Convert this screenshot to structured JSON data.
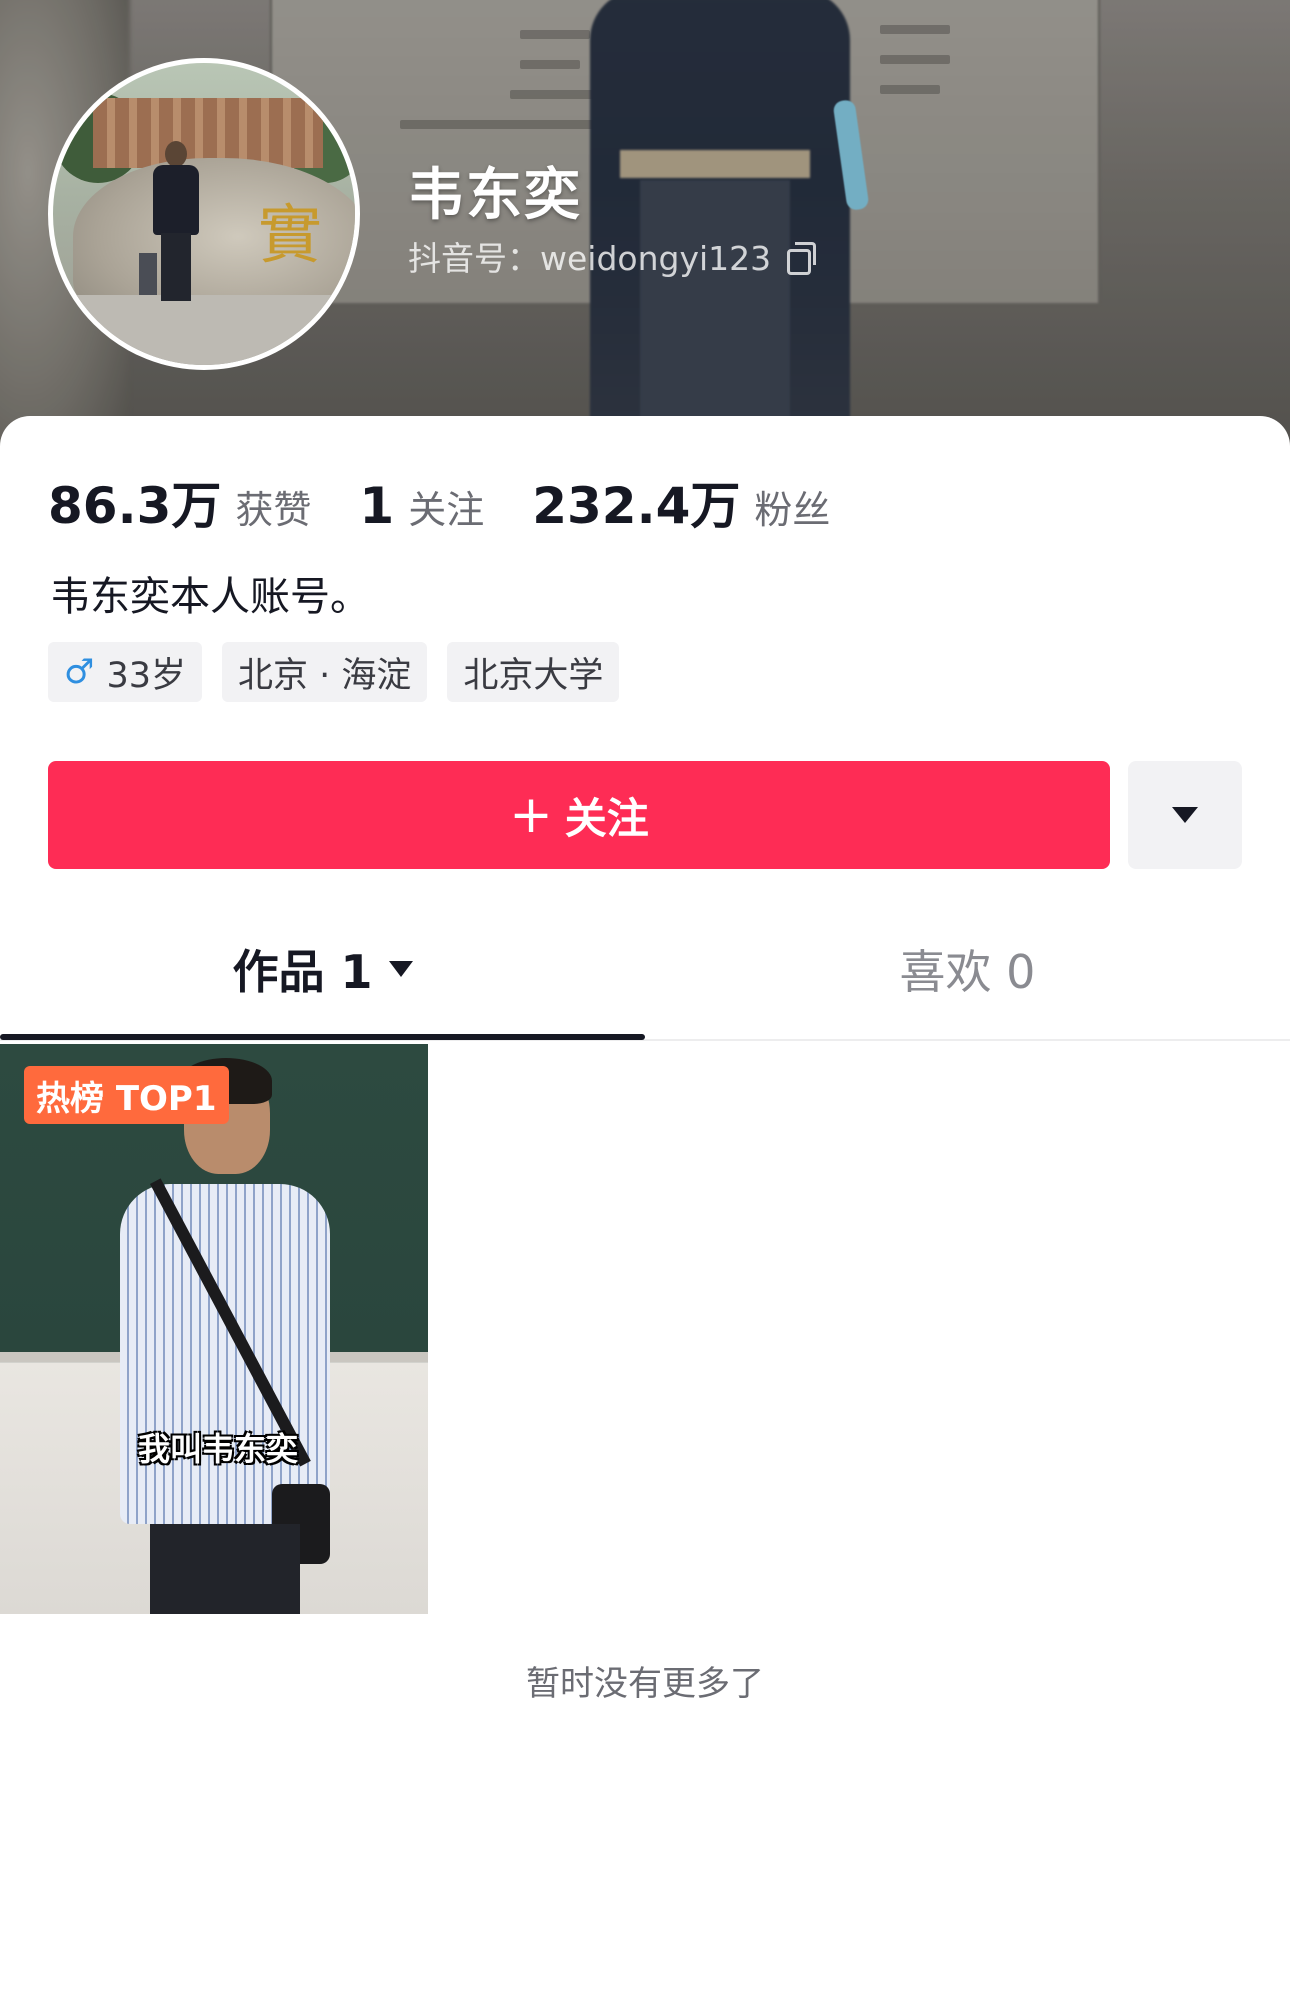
{
  "profile": {
    "nickname": "韦东奕",
    "douyin_id": "抖音号：weidongyi123",
    "bio": "韦东奕本人账号。"
  },
  "stats": [
    {
      "value": "86.3万",
      "label": "获赞"
    },
    {
      "value": "1",
      "label": "关注"
    },
    {
      "value": "232.4万",
      "label": "粉丝"
    }
  ],
  "tags": {
    "gender_symbol": "♂",
    "age": "33岁",
    "location": "北京 · 海淀",
    "school": "北京大学"
  },
  "actions": {
    "follow_plus": "+",
    "follow_label": "关注"
  },
  "tabs": {
    "works": "作品 1",
    "likes": "喜欢 0"
  },
  "videos": [
    {
      "badge": "热榜 TOP1",
      "subtitle": "我叫韦东奕"
    }
  ],
  "footer": {
    "no_more": "暂时没有更多了"
  },
  "colors": {
    "accent": "#fe2c55",
    "badge": "#ff6a3d",
    "male": "#2f8fe0"
  }
}
